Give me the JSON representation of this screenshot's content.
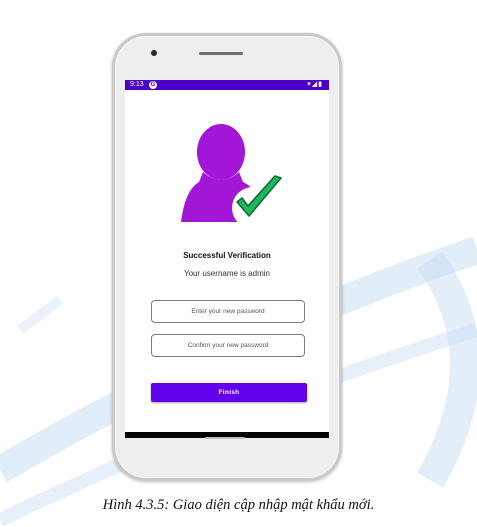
{
  "status_bar": {
    "time": "9:13",
    "app_icon": "G",
    "indicators": "▾◢▮"
  },
  "screen": {
    "title": "Successful Verification",
    "subtitle": "Your username is admin",
    "new_password_placeholder": "Enter your new password",
    "confirm_password_placeholder": "Confirm your new password",
    "finish_label": "Finish"
  },
  "colors": {
    "status_bar": "#4b00c8",
    "button": "#6200ee",
    "avatar": "#a316d8",
    "check": "#1db85b"
  },
  "caption": "Hình 4.3.5: Giao diện cập nhập mật khẩu mới.",
  "icons": [
    "user-silhouette-icon",
    "checkmark-icon"
  ]
}
